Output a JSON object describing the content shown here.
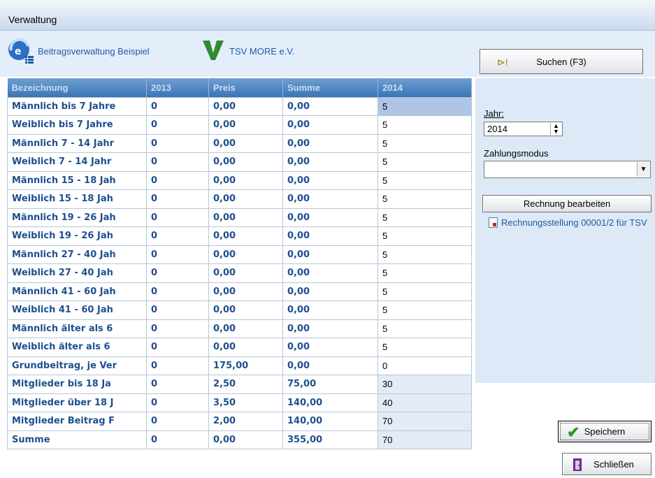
{
  "window": {
    "title": "Verwaltung"
  },
  "header": {
    "logo_left_text": "Beitragsverwaltung Beispiel",
    "logo_right_text": "TSV MORE e.V."
  },
  "search_button": {
    "label": "Suchen (F3)"
  },
  "table": {
    "columns": [
      "Bezeichnung",
      "2013",
      "Preis",
      "Summe",
      "2014"
    ],
    "rows": [
      [
        "Männlich bis 7 Jahre",
        "0",
        "0,00",
        "0,00",
        "5"
      ],
      [
        "Weiblich bis 7 Jahre",
        "0",
        "0,00",
        "0,00",
        "5"
      ],
      [
        "Männlich 7 - 14 Jahr",
        "0",
        "0,00",
        "0,00",
        "5"
      ],
      [
        "Weiblich 7 - 14 Jahr",
        "0",
        "0,00",
        "0,00",
        "5"
      ],
      [
        "Männlich 15 - 18 Jah",
        "0",
        "0,00",
        "0,00",
        "5"
      ],
      [
        "Weiblich 15 - 18 Jah",
        "0",
        "0,00",
        "0,00",
        "5"
      ],
      [
        "Männlich 19 - 26 Jah",
        "0",
        "0,00",
        "0,00",
        "5"
      ],
      [
        "Weiblich 19 - 26 Jah",
        "0",
        "0,00",
        "0,00",
        "5"
      ],
      [
        "Männlich 27 - 40 Jah",
        "0",
        "0,00",
        "0,00",
        "5"
      ],
      [
        "Weiblich 27 - 40 Jah",
        "0",
        "0,00",
        "0,00",
        "5"
      ],
      [
        "Männlich 41 - 60 Jah",
        "0",
        "0,00",
        "0,00",
        "5"
      ],
      [
        "Weiblich 41 - 60 Jah",
        "0",
        "0,00",
        "0,00",
        "5"
      ],
      [
        "Männlich älter als 6",
        "0",
        "0,00",
        "0,00",
        "5"
      ],
      [
        "Weiblich älter als 6",
        "0",
        "0,00",
        "0,00",
        "5"
      ],
      [
        "Grundbeitrag, je Ver",
        "0",
        "175,00",
        "0,00",
        "0"
      ],
      [
        "Mitglieder bis 18 Ja",
        "0",
        "2,50",
        "75,00",
        "30"
      ],
      [
        "Mitglieder über 18 J",
        "0",
        "3,50",
        "140,00",
        "40"
      ],
      [
        "Mitglieder Beitrag F",
        "0",
        "2,00",
        "140,00",
        "70"
      ],
      [
        "Summe",
        "0",
        "0,00",
        "355,00",
        "70"
      ]
    ]
  },
  "form": {
    "year_label": "Jahr:",
    "year_value": "2014",
    "payment_mode_label": "Zahlungsmodus",
    "payment_mode_value": "",
    "edit_invoice_label": "Rechnung bearbeiten",
    "invoice_link": "Rechnungsstellung 00001/2 für TSV"
  },
  "footer": {
    "save_label": "Speichern",
    "close_label": "Schließen"
  },
  "colors": {
    "header_bg": "#e4eefa",
    "table_header": "#3a74b5",
    "text_blue": "#1f4f8f",
    "panel_bg": "#dde9f6"
  }
}
